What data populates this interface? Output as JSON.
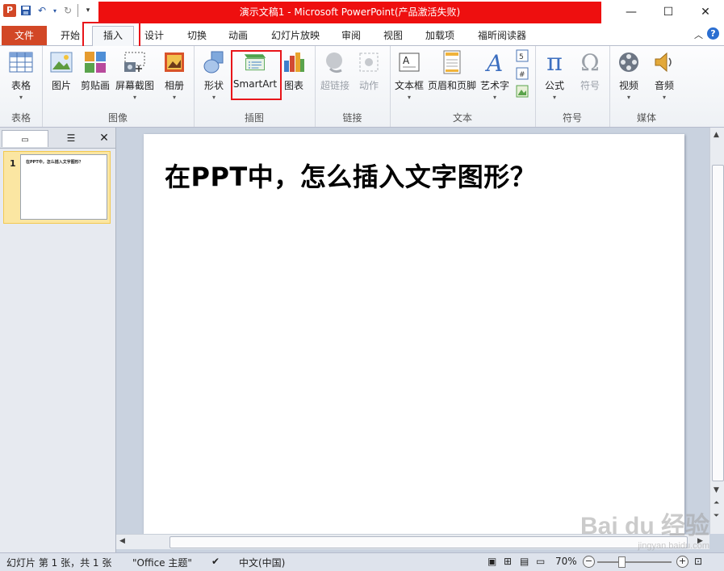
{
  "window": {
    "title": "演示文稿1  -  Microsoft PowerPoint(产品激活失败)",
    "controls": {
      "minimize": "—",
      "maximize": "☐",
      "close": "✕"
    }
  },
  "tabs": [
    "文件",
    "开始",
    "插入",
    "设计",
    "切换",
    "动画",
    "幻灯片放映",
    "审阅",
    "视图",
    "加载项",
    "福昕阅读器"
  ],
  "active_tab": "插入",
  "ribbon": {
    "groups": {
      "table": "表格",
      "images": "图像",
      "illustrations": "插图",
      "links": "链接",
      "text": "文本",
      "symbols": "符号",
      "media": "媒体"
    },
    "buttons": {
      "table": "表格",
      "picture": "图片",
      "clipart": "剪贴画",
      "screenshot": "屏幕截图",
      "album": "相册",
      "shapes": "形状",
      "smartart": "SmartArt",
      "chart": "图表",
      "hyperlink": "超链接",
      "action": "动作",
      "textbox": "文本框",
      "header_footer": "页眉和页脚",
      "wordart": "艺术字",
      "equation": "公式",
      "symbol": "符号",
      "video": "视频",
      "audio": "音频"
    }
  },
  "slides_panel": {
    "close": "✕",
    "slide_number": "1",
    "thumb_title": "在PPT中，怎么插入文字图形？"
  },
  "slide": {
    "title": "在PPT中，怎么插入文字图形？"
  },
  "status": {
    "slide_info": "幻灯片 第 1 张，共 1 张",
    "theme": "\"Office 主题\"",
    "language": "中文(中国)",
    "zoom": "70%"
  },
  "watermark": {
    "main": "Bai du 经验",
    "sub": "jingyan.baidu.com"
  }
}
